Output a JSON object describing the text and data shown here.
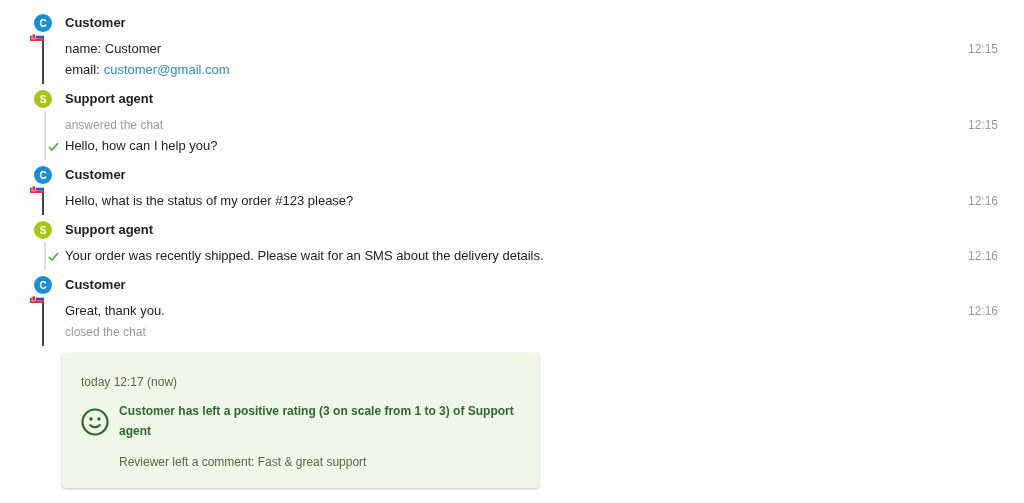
{
  "messages": [
    {
      "kind": "customer",
      "avatar": "C",
      "author": "Customer",
      "time": "12:15",
      "lines": [
        {
          "kind": "text",
          "text": "name: Customer"
        },
        {
          "kind": "field",
          "label": "email:",
          "link": "customer@gmail.com"
        }
      ]
    },
    {
      "kind": "agent",
      "avatar": "S",
      "author": "Support agent",
      "time": "12:15",
      "lines": [
        {
          "kind": "event",
          "text": "answered the chat"
        },
        {
          "kind": "text",
          "text": "Hello, how can I help you?",
          "delivered": true
        }
      ]
    },
    {
      "kind": "customer",
      "avatar": "C",
      "author": "Customer",
      "time": "12:16",
      "lines": [
        {
          "kind": "text",
          "text": "Hello, what is the status of my order #123 please?"
        }
      ]
    },
    {
      "kind": "agent",
      "avatar": "S",
      "author": "Support agent",
      "time": "12:16",
      "lines": [
        {
          "kind": "text",
          "text": "Your order was recently shipped. Please wait for an SMS about the delivery details.",
          "delivered": true
        }
      ]
    },
    {
      "kind": "customer",
      "avatar": "C",
      "author": "Customer",
      "time": "12:16",
      "lines": [
        {
          "kind": "text",
          "text": "Great, thank you."
        },
        {
          "kind": "event",
          "text": "closed the chat"
        }
      ]
    }
  ],
  "rating": {
    "time": "today 12:17 (now)",
    "kind": "positive",
    "summary": "Customer has left a positive rating (3 on scale from 1 to 3) of Support agent",
    "comment": "Reviewer left a comment: Fast & great support"
  }
}
